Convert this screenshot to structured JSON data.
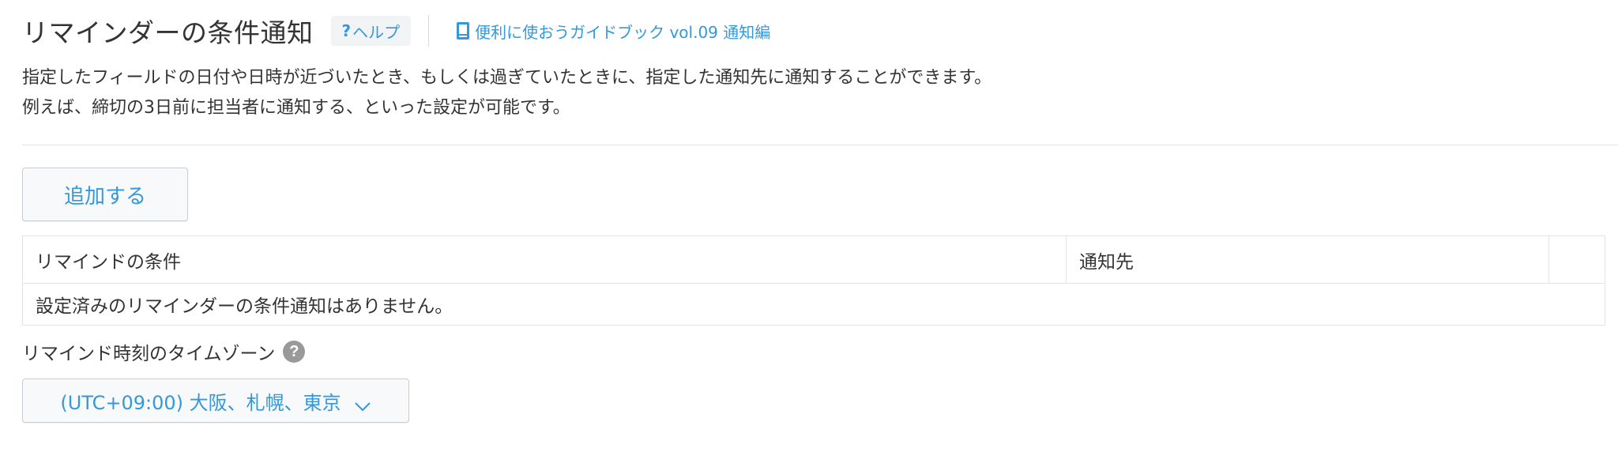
{
  "header": {
    "title": "リマインダーの条件通知",
    "help_mark": "?",
    "help_label": "ヘルプ",
    "guide_link": "便利に使おうガイドブック vol.09 通知編"
  },
  "description": {
    "line1": "指定したフィールドの日付や日時が近づいたとき、もしくは過ぎていたときに、指定した通知先に通知することができます。",
    "line2": "例えば、締切の3日前に担当者に通知する、といった設定が可能です。"
  },
  "actions": {
    "add_label": "追加する"
  },
  "table": {
    "columns": [
      "リマインドの条件",
      "通知先",
      ""
    ],
    "empty_message": "設定済みのリマインダーの条件通知はありません。"
  },
  "timezone": {
    "label": "リマインド時刻のタイムゾーン",
    "help_mark": "?",
    "selected": "(UTC+09:00) 大阪、札幌、東京"
  },
  "colors": {
    "accent": "#3498db",
    "text": "#333333",
    "border": "#e3e3e3",
    "button_bg": "#f7f9fa"
  },
  "icons": {
    "guide": "book-icon",
    "timezone_help": "question-circle-icon",
    "select": "chevron-down-icon"
  }
}
